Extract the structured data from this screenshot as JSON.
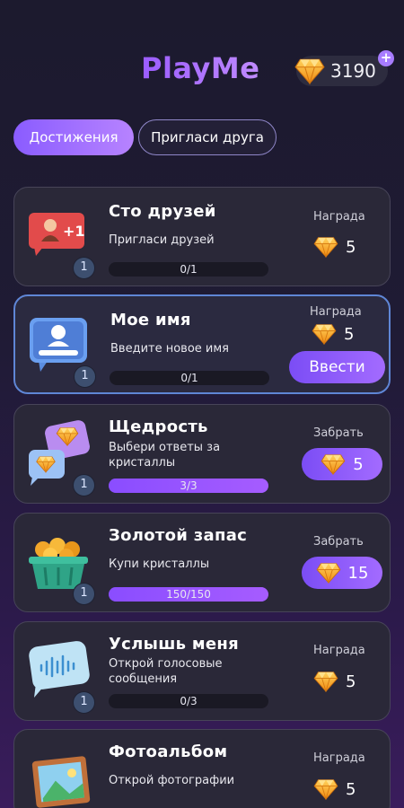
{
  "header": {
    "app_name": "PlayMe",
    "balance": "3190",
    "plus": "+"
  },
  "tabs": [
    {
      "label": "Достижения",
      "active": true
    },
    {
      "label": "Пригласи друга",
      "active": false
    }
  ],
  "achievements": [
    {
      "title": "Сто друзей",
      "desc": "Пригласи друзей",
      "progress_text": "0/1",
      "progress": 0,
      "level": "1",
      "reward_label": "Награда",
      "reward": "5",
      "icon": "friend-plus-icon"
    },
    {
      "title": "Мое имя",
      "desc": "Введите новое имя",
      "progress_text": "0/1",
      "progress": 0,
      "level": "1",
      "reward_label": "Награда",
      "reward": "5",
      "button_label": "Ввести",
      "icon": "profile-card-icon"
    },
    {
      "title": "Щедрость",
      "desc": "Выбери ответы за кристаллы",
      "progress_text": "3/3",
      "progress": 1,
      "level": "1",
      "reward_label": "Забрать",
      "reward": "5",
      "icon": "crystal-chat-icon"
    },
    {
      "title": "Золотой запас",
      "desc": "Купи кристаллы",
      "progress_text": "150/150",
      "progress": 1,
      "level": "1",
      "reward_label": "Забрать",
      "reward": "15",
      "icon": "gold-basket-icon"
    },
    {
      "title": "Услышь меня",
      "desc": "Открой голосовые сообщения",
      "progress_text": "0/3",
      "progress": 0,
      "level": "1",
      "reward_label": "Награда",
      "reward": "5",
      "icon": "voice-message-icon"
    },
    {
      "title": "Фотоальбом",
      "desc": "Открой фотографии",
      "progress_text": "",
      "progress": 0,
      "level": "",
      "reward_label": "Награда",
      "reward": "5",
      "icon": "photo-frame-icon"
    }
  ],
  "colors": {
    "accent": "#8a5cff",
    "card_bg": "#2a2838",
    "highlight_border": "#5f86d6",
    "gem": "#f7a51c"
  }
}
